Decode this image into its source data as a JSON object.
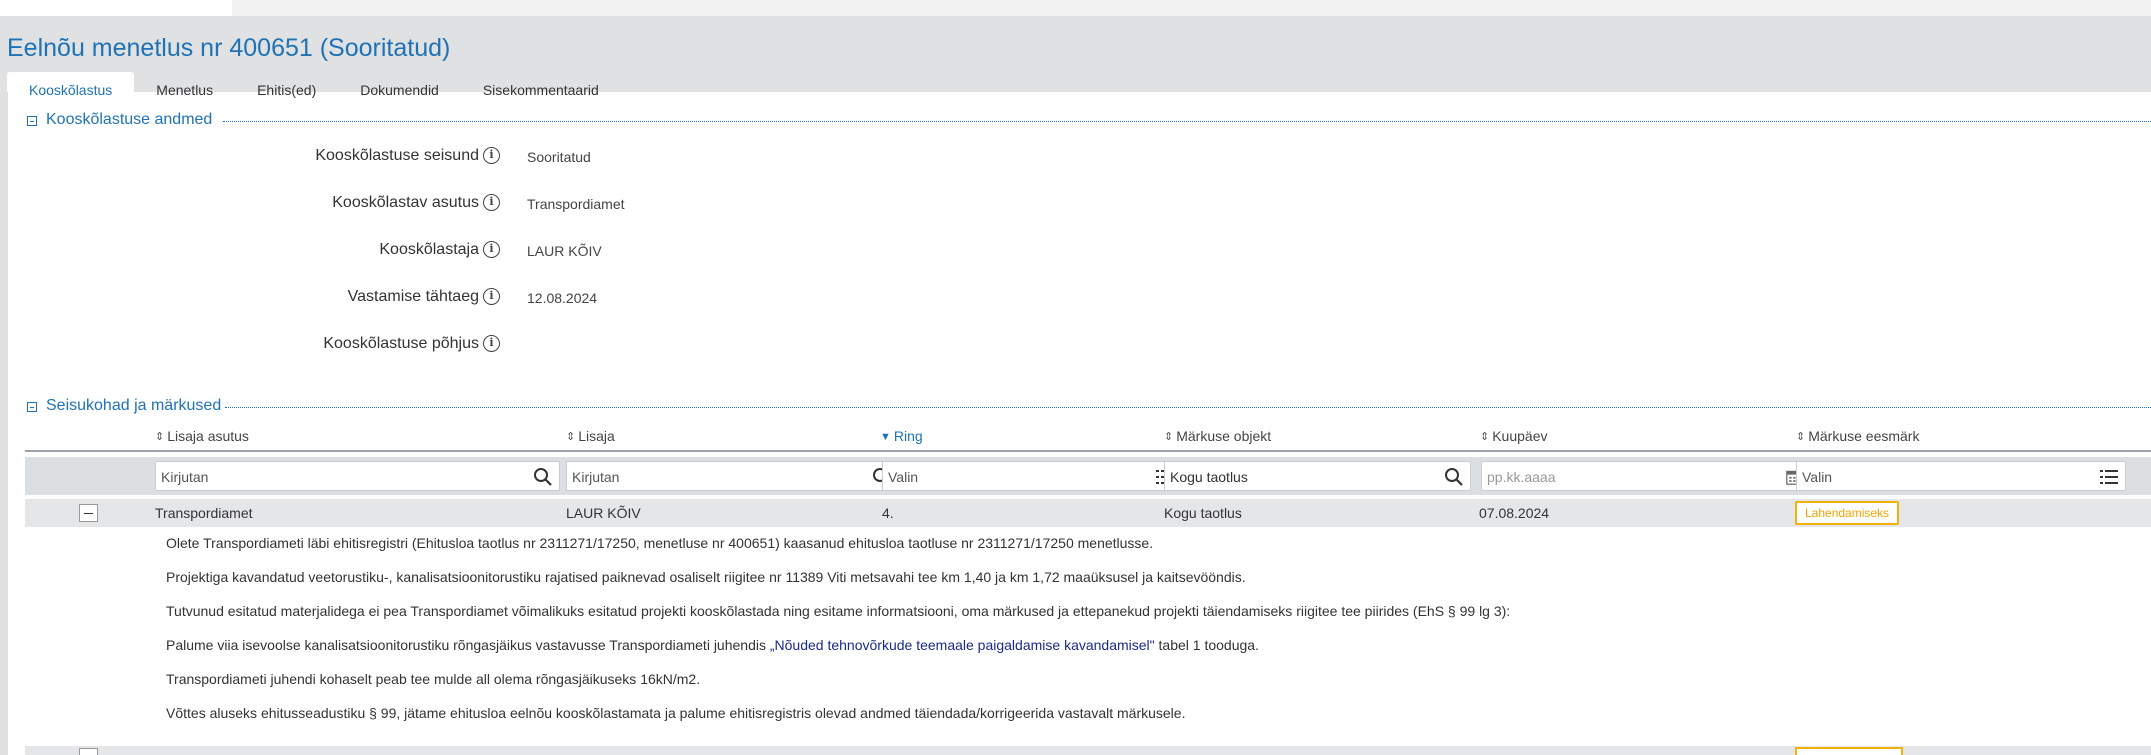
{
  "header": {
    "title": "Eelnõu menetlus nr 400651 (Sooritatud)"
  },
  "tabs": [
    {
      "label": "Kooskõlastus",
      "active": true
    },
    {
      "label": "Menetlus",
      "active": false
    },
    {
      "label": "Ehitis(ed)",
      "active": false
    },
    {
      "label": "Dokumendid",
      "active": false
    },
    {
      "label": "Sisekommentaarid",
      "active": false
    }
  ],
  "approval_section": {
    "title": "Kooskõlastuse andmed",
    "fields": [
      {
        "label": "Kooskõlastuse seisund",
        "value": "Sooritatud"
      },
      {
        "label": "Kooskõlastav asutus",
        "value": "Transpordiamet"
      },
      {
        "label": "Kooskõlastaja",
        "value": "LAUR KÕIV"
      },
      {
        "label": "Vastamise tähtaeg",
        "value": "12.08.2024"
      },
      {
        "label": "Kooskõlastuse põhjus",
        "value": ""
      }
    ]
  },
  "remarks_section": {
    "title": "Seisukohad ja märkused",
    "columns": [
      {
        "label": "Lisaja asutus",
        "sorted": false
      },
      {
        "label": "Lisaja",
        "sorted": false
      },
      {
        "label": "Ring",
        "sorted": true
      },
      {
        "label": "Märkuse objekt",
        "sorted": false
      },
      {
        "label": "Kuupäev",
        "sorted": false
      },
      {
        "label": "Märkuse eesmärk",
        "sorted": false
      }
    ],
    "filters": [
      {
        "placeholder": "Kirjutan",
        "icon": "search-icon"
      },
      {
        "placeholder": "Kirjutan",
        "icon": "search-icon"
      },
      {
        "placeholder": "Valin",
        "icon": "list-icon"
      },
      {
        "value": "Kogu taotlus",
        "icon": "search-icon"
      },
      {
        "placeholder": "pp.kk.aaaa",
        "icon": "calendar-icon"
      },
      {
        "placeholder": "Valin",
        "icon": "list-icon"
      }
    ],
    "rows": [
      {
        "asutus": "Transpordiamet",
        "lisaja": "LAUR KÕIV",
        "ring": "4.",
        "objekt": "Kogu taotlus",
        "kuupaev": "07.08.2024",
        "eesmark": "Lahendamiseks",
        "details": [
          "Olete Transpordiameti läbi ehitisregistri (Ehitusloa taotlus nr 2311271/17250, menetluse nr 400651) kaasanud ehitusloa taotluse nr 2311271/17250 menetlusse.",
          "Projektiga kavandatud veetorustiku-, kanalisatsioonitorustiku rajatised paiknevad osaliselt riigitee nr 11389 Viti metsavahi tee km 1,40 ja km 1,72 maaüksusel ja kaitsevööndis.",
          "Tutvunud esitatud materjalidega ei pea Transpordiamet võimalikuks esitatud projekti kooskõlastada ning esitame informatsiooni, oma märkused ja ettepanekud projekti täiendamiseks riigitee tee piirides (EhS § 99 lg 3):",
          "Transpordiameti juhendi kohaselt peab tee mulde all olema rõngasjäikuseks 16kN/m2.",
          "Võttes aluseks ehitusseadustiku § 99, jätame ehitusloa eelnõu kooskõlastamata ja palume ehitisregistris olevad andmed täiendada/korrigeerida vastavalt märkusele."
        ],
        "detail_with_link": {
          "before": "Palume viia isevoolse kanalisatsioonitorustiku rõngasjäikus vastavusse Transpordiameti juhendis ",
          "link": "„Nõuded tehnovõrkude teemaale paigaldamise kavandamisel\"",
          "after": " tabel 1 tooduga."
        }
      }
    ]
  },
  "colors": {
    "accent": "#1f72b5",
    "header_bg": "#dfe1e3",
    "badge": "#f2b20e"
  }
}
